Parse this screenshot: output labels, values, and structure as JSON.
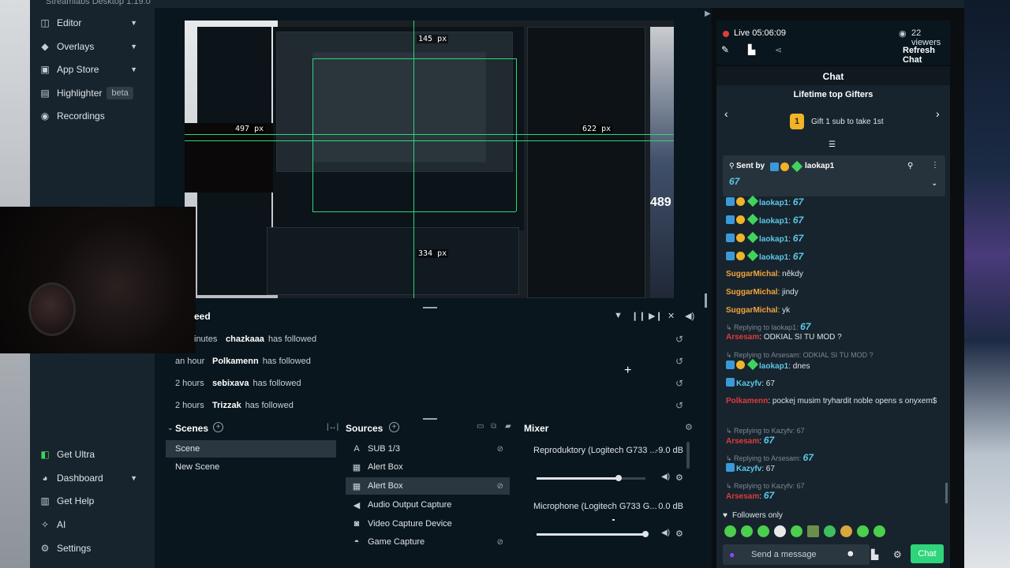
{
  "app": {
    "title": "Streamlabs Desktop 1.19.0"
  },
  "sidebar": {
    "top_items": [
      {
        "label": "Editor",
        "icon": "editor-icon"
      },
      {
        "label": "Overlays",
        "icon": "overlays-icon"
      },
      {
        "label": "App Store",
        "icon": "app-store-icon"
      },
      {
        "label": "Highlighter",
        "icon": "highlighter-icon",
        "badge": "beta"
      },
      {
        "label": "Recordings",
        "icon": "recordings-icon"
      }
    ],
    "bottom_items": [
      {
        "label": "Get Ultra",
        "icon": "ultra-icon"
      },
      {
        "label": "Dashboard",
        "icon": "dashboard-icon"
      },
      {
        "label": "Get Help",
        "icon": "help-icon"
      },
      {
        "label": "AI",
        "icon": "ai-icon"
      },
      {
        "label": "Settings",
        "icon": "settings-icon"
      }
    ]
  },
  "preview": {
    "measure_labels": [
      "145 px",
      "497 px",
      "622 px",
      "334 px"
    ],
    "overlay_number": "489"
  },
  "feed": {
    "title": "eed",
    "items": [
      {
        "time": "inutes",
        "user": "chazkaaa",
        "action": "has followed"
      },
      {
        "time": "an hour",
        "user": "Polkamenn",
        "action": "has followed"
      },
      {
        "time": "2 hours",
        "user": "sebixava",
        "action": "has followed"
      },
      {
        "time": "2 hours",
        "user": "Trizzak",
        "action": "has followed"
      }
    ]
  },
  "scenes": {
    "title": "Scenes",
    "items": [
      "Scene",
      "New Scene"
    ],
    "selected": "Scene"
  },
  "sources": {
    "title": "Sources",
    "items": [
      {
        "label": "SUB 1/3",
        "icon": "text-icon",
        "hidden": true
      },
      {
        "label": "Alert Box",
        "icon": "alert-box-icon",
        "hidden": false
      },
      {
        "label": "Alert Box",
        "icon": "alert-box-icon",
        "hidden": true
      },
      {
        "label": "Audio Output Capture",
        "icon": "speaker-icon",
        "hidden": false
      },
      {
        "label": "Video Capture Device",
        "icon": "camera-icon",
        "hidden": false
      },
      {
        "label": "Game Capture",
        "icon": "gamepad-icon",
        "hidden": true
      }
    ]
  },
  "mixer": {
    "title": "Mixer",
    "channels": [
      {
        "name": "Reproduktory (Logitech G733 ...",
        "db": "-9.0 dB",
        "level": 0.75
      },
      {
        "name": "Microphone (Logitech G733 G...",
        "db": "0.0 dB",
        "level": 1.0
      }
    ]
  },
  "chat_header": {
    "live_label": "Live 05:06:09",
    "viewers": "22 viewers",
    "refresh": "Refresh Chat",
    "live_color": "#e03b3b"
  },
  "chat": {
    "title": "Chat",
    "gifters_title": "Lifetime top Gifters",
    "gifters_sub": "Gift 1 sub to take 1st",
    "gifters_rank": "1",
    "pinned_label": "Sent by",
    "pinned_user": "laokap1",
    "pinned_msg": "67",
    "messages": [
      {
        "kind": "badge",
        "user": "laokap1",
        "text": "67",
        "color": "#5cc7e8"
      },
      {
        "kind": "badge",
        "user": "laokap1",
        "text": "67",
        "color": "#5cc7e8"
      },
      {
        "kind": "badge",
        "user": "laokap1",
        "text": "67",
        "color": "#5cc7e8"
      },
      {
        "kind": "badge",
        "user": "laokap1",
        "text": "67",
        "color": "#5cc7e8"
      },
      {
        "kind": "plain",
        "user": "SuggarMichal",
        "text": ": někdy",
        "color": "#f3a33b"
      },
      {
        "kind": "plain",
        "user": "SuggarMichal",
        "text": ": jindy",
        "color": "#f3a33b"
      },
      {
        "kind": "plain",
        "user": "SuggarMichal",
        "text": ": yk",
        "color": "#f3a33b"
      }
    ],
    "reply1_line": "Replying to laokap1:",
    "reply1_emote": "67",
    "arsesam1_user": "Arsesam",
    "arsesam1_text": ": ODKIAL SI TU MOD ?",
    "reply2_line": "Replying to Arsesam: ODKIAL SI TU MOD ?",
    "laokap_dnes_user": "laokap1",
    "laokap_dnes_text": ": dnes",
    "kazyfv1_user": "Kazyfv",
    "kazyfv1_text": ": 67",
    "polka_user": "Polkamenn",
    "polka_text": ": pockej musim tryhardit noble opens s onyxem$",
    "reply3_line": "Replying to Kazyfv: 67",
    "arsesam2_user": "Arsesam",
    "arsesam2_text": "67",
    "reply4_line": "Replying to Arsesam:",
    "reply4_emote": "67",
    "kazyfv2_user": "Kazyfv",
    "kazyfv2_text": ": 67",
    "reply5_line": "Replying to Kazyfv: 67",
    "arsesam3_user": "Arsesam",
    "arsesam3_text": "67",
    "followers_only": "Followers only",
    "input_placeholder": "Send a message",
    "send_label": "Chat",
    "accent": "#2fd57a"
  }
}
